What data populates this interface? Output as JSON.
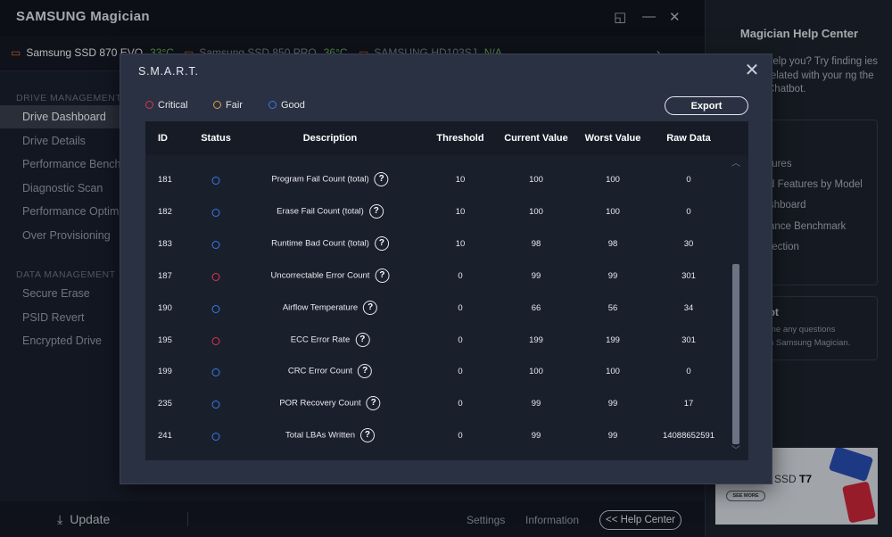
{
  "app": {
    "title": "SAMSUNG Magician",
    "window_controls": {
      "restore": "◱",
      "minimize": "—",
      "close": "✕"
    },
    "drives": [
      {
        "name": "Samsung SSD 870 EVO",
        "temp": "33°C"
      },
      {
        "name": "Samsung SSD 850 PRO",
        "temp": "36°C"
      },
      {
        "name": "SAMSUNG HD103SJ",
        "temp": "N/A"
      }
    ],
    "drives_more": "›",
    "sidebar": {
      "drive_management_label": "DRIVE MANAGEMENT",
      "drive_items": [
        "Drive Dashboard",
        "Drive Details",
        "Performance Benchmark",
        "Diagnostic Scan",
        "Performance Optimization",
        "Over Provisioning"
      ],
      "data_management_label": "DATA MANAGEMENT",
      "data_items": [
        "Secure Erase",
        "PSID Revert",
        "Encrypted Drive"
      ]
    },
    "bottom": {
      "update_label": "Update",
      "settings_label": "Settings",
      "information_label": "Information",
      "help_center_label": "<< Help Center"
    }
  },
  "help_panel": {
    "title": "Magician Help Center",
    "intro": "help you? Try finding ies related with your ng the Chatbot.",
    "links": [
      "tures",
      "d Features by Model",
      "shboard",
      "ance Benchmark",
      "tection"
    ],
    "chatbot_title": "ot",
    "chatbot_text_1": "me any questions",
    "chatbot_text_2": "h Samsung Magician.",
    "promo_text_a": "SSD ",
    "promo_text_b": "T7",
    "promo_more": "SEE MORE"
  },
  "smart": {
    "title": "S.M.A.R.T.",
    "close_glyph": "✕",
    "legend": {
      "critical": "Critical",
      "fair": "Fair",
      "good": "Good"
    },
    "export_label": "Export",
    "headers": {
      "id": "ID",
      "status": "Status",
      "description": "Description",
      "threshold": "Threshold",
      "current": "Current Value",
      "worst": "Worst Value",
      "raw": "Raw Data"
    },
    "help_glyph": "?",
    "scroll_up": "︿",
    "scroll_down": "﹀",
    "rows": [
      {
        "id": "181",
        "status": "good",
        "description": "Program Fail Count (total)",
        "threshold": "10",
        "current": "100",
        "worst": "100",
        "raw": "0"
      },
      {
        "id": "182",
        "status": "good",
        "description": "Erase Fail Count (total)",
        "threshold": "10",
        "current": "100",
        "worst": "100",
        "raw": "0"
      },
      {
        "id": "183",
        "status": "good",
        "description": "Runtime Bad Count (total)",
        "threshold": "10",
        "current": "98",
        "worst": "98",
        "raw": "30"
      },
      {
        "id": "187",
        "status": "critical",
        "description": "Uncorrectable Error Count",
        "threshold": "0",
        "current": "99",
        "worst": "99",
        "raw": "301"
      },
      {
        "id": "190",
        "status": "good",
        "description": "Airflow Temperature",
        "threshold": "0",
        "current": "66",
        "worst": "56",
        "raw": "34"
      },
      {
        "id": "195",
        "status": "critical",
        "description": "ECC Error Rate",
        "threshold": "0",
        "current": "199",
        "worst": "199",
        "raw": "301"
      },
      {
        "id": "199",
        "status": "good",
        "description": "CRC Error Count",
        "threshold": "0",
        "current": "100",
        "worst": "100",
        "raw": "0"
      },
      {
        "id": "235",
        "status": "good",
        "description": "POR Recovery Count",
        "threshold": "0",
        "current": "99",
        "worst": "99",
        "raw": "17"
      },
      {
        "id": "241",
        "status": "good",
        "description": "Total LBAs Written",
        "threshold": "0",
        "current": "99",
        "worst": "99",
        "raw": "14088652591"
      }
    ]
  },
  "colors": {
    "critical": "#e0344a",
    "fair": "#e0a040",
    "good": "#3a7ae8",
    "modal_bg": "#2a3142",
    "table_bg": "#1a1f2c"
  }
}
